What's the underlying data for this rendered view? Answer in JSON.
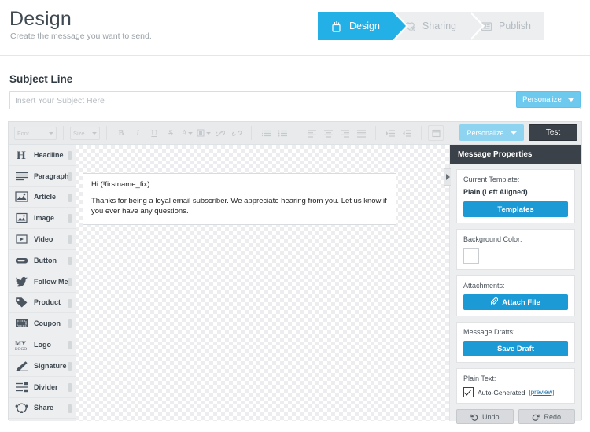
{
  "header": {
    "title": "Design",
    "subtitle": "Create the message you want to send.",
    "steps": [
      {
        "label": "Design",
        "icon": "design-cup-icon",
        "active": true
      },
      {
        "label": "Sharing",
        "icon": "heart-plus-icon",
        "active": false
      },
      {
        "label": "Publish",
        "icon": "list-document-icon",
        "active": false
      }
    ]
  },
  "subject": {
    "label": "Subject Line",
    "placeholder": "Insert Your Subject Here",
    "value": "",
    "personalize_label": "Personalize"
  },
  "toolbar": {
    "font_select": "Font",
    "size_select": "Size",
    "buttons": [
      {
        "name": "bold-icon",
        "glyph": "B"
      },
      {
        "name": "italic-icon",
        "glyph": "I"
      },
      {
        "name": "underline-icon",
        "glyph": "U"
      },
      {
        "name": "strikethrough-icon",
        "glyph": "S"
      },
      {
        "name": "text-color-icon",
        "glyph": "A"
      },
      {
        "name": "highlight-color-icon",
        "glyph": "■"
      },
      {
        "name": "link-icon",
        "glyph": "⚭"
      },
      {
        "name": "unlink-icon",
        "glyph": "⚭"
      }
    ],
    "personalize_label": "Personalize",
    "test_label": "Test"
  },
  "blocks": [
    {
      "label": "Headline",
      "icon": "headline-icon"
    },
    {
      "label": "Paragraph",
      "icon": "paragraph-icon"
    },
    {
      "label": "Article",
      "icon": "article-icon"
    },
    {
      "label": "Image",
      "icon": "image-icon"
    },
    {
      "label": "Video",
      "icon": "video-icon"
    },
    {
      "label": "Button",
      "icon": "button-icon"
    },
    {
      "label": "Follow Me",
      "icon": "twitter-bird-icon"
    },
    {
      "label": "Product",
      "icon": "tag-icon"
    },
    {
      "label": "Coupon",
      "icon": "coupon-icon"
    },
    {
      "label": "Logo",
      "icon": "my-logo-icon"
    },
    {
      "label": "Signature",
      "icon": "pen-icon"
    },
    {
      "label": "Divider",
      "icon": "divider-icon"
    },
    {
      "label": "Share",
      "icon": "share-icon"
    }
  ],
  "message": {
    "greeting": "Hi (!firstname_fix)",
    "body": "Thanks for being a loyal email subscriber. We appreciate hearing from you. Let us know if you ever have any questions."
  },
  "properties": {
    "header": "Message Properties",
    "template": {
      "label": "Current Template:",
      "value": "Plain (Left Aligned)",
      "button": "Templates"
    },
    "background": {
      "label": "Background Color:",
      "color": "#ffffff"
    },
    "attachments": {
      "label": "Attachments:",
      "button": "Attach File"
    },
    "drafts": {
      "label": "Message Drafts:",
      "button": "Save Draft"
    },
    "plain_text": {
      "label": "Plain Text:",
      "checkbox_label": "Auto-Generated",
      "preview_link": "[preview]",
      "checked": true
    },
    "undo_label": "Undo",
    "redo_label": "Redo"
  },
  "colors": {
    "accent": "#22b0e6",
    "button_blue": "#1b9ad6",
    "dark": "#3b4148"
  }
}
